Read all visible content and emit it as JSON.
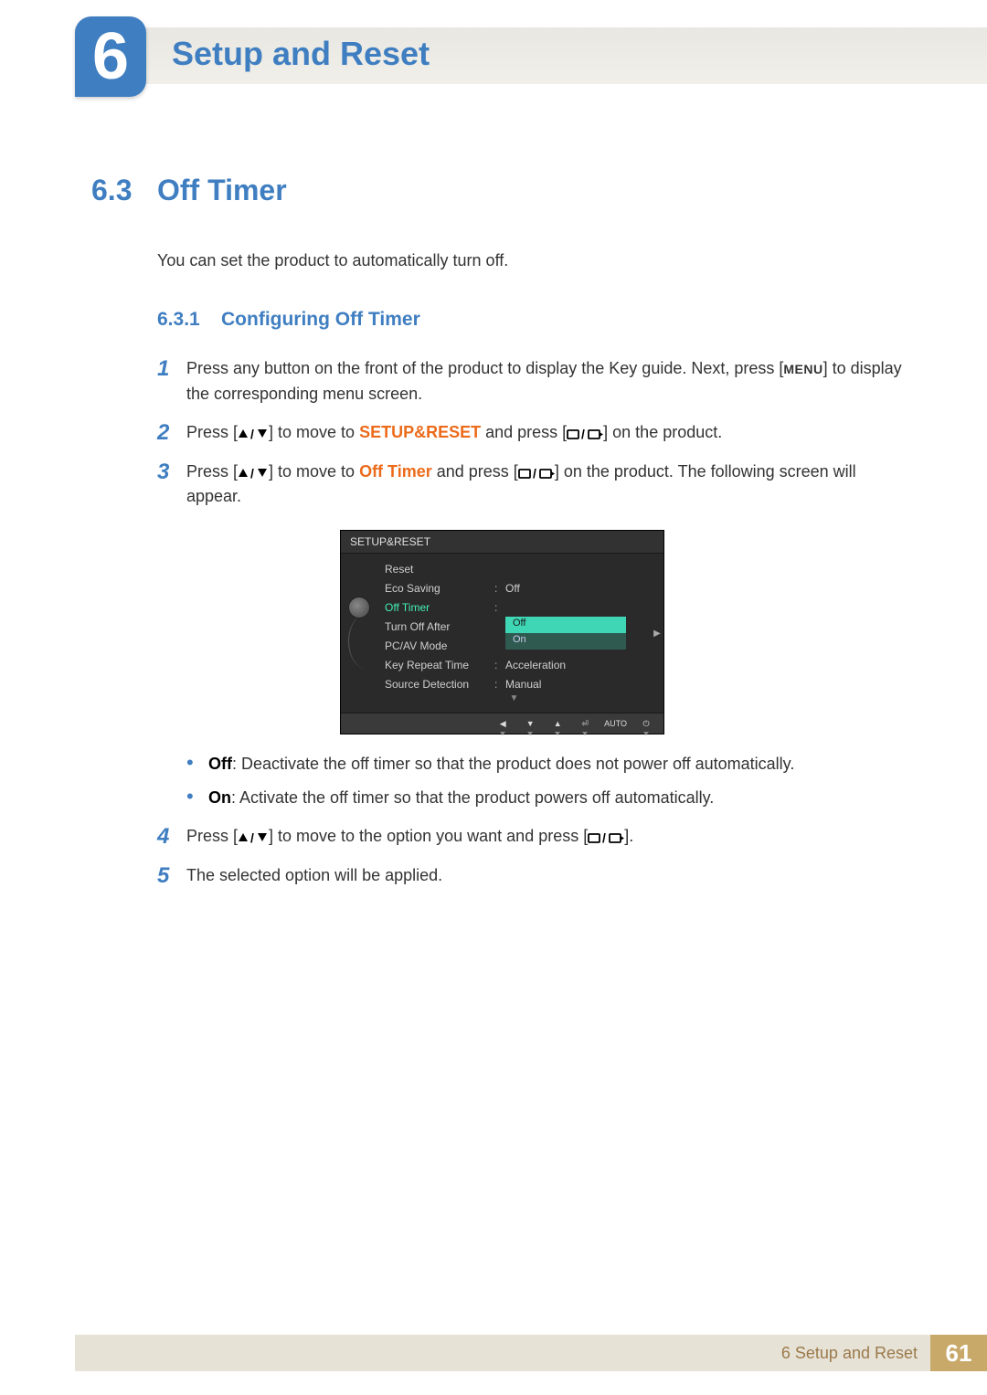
{
  "chapter": {
    "number": "6",
    "title": "Setup and Reset"
  },
  "section": {
    "number": "6.3",
    "title": "Off Timer"
  },
  "intro": "You can set the product to automatically turn off.",
  "subsection": {
    "number": "6.3.1",
    "title": "Configuring Off Timer"
  },
  "steps": {
    "s1": {
      "num": "1",
      "pre": "Press any button on the front of the product to display the Key guide. Next, press [",
      "menu": "MENU",
      "post": "] to display the corresponding menu screen."
    },
    "s2": {
      "num": "2",
      "pre": "Press [",
      "mid": "] to move to ",
      "target": "SETUP&RESET",
      "post1": " and press [",
      "post2": "] on the product."
    },
    "s3": {
      "num": "3",
      "pre": "Press [",
      "mid": "] to move to ",
      "target": "Off Timer",
      "post1": " and press [",
      "post2": "] on the product. The following screen will appear."
    },
    "s4": {
      "num": "4",
      "pre": "Press [",
      "mid": "] to move to the option you want and press [",
      "post": "]."
    },
    "s5": {
      "num": "5",
      "text": "The selected option will be applied."
    }
  },
  "osd": {
    "title": "SETUP&RESET",
    "items": {
      "reset": "Reset",
      "eco": "Eco Saving",
      "eco_val": "Off",
      "off_timer": "Off Timer",
      "turn_off_after": "Turn Off After",
      "pcav": "PC/AV Mode",
      "key_repeat": "Key Repeat Time",
      "key_repeat_val": "Acceleration",
      "source": "Source Detection",
      "source_val": "Manual"
    },
    "dropdown": {
      "off": "Off",
      "on": "On"
    },
    "footer": {
      "auto": "AUTO"
    }
  },
  "bullets": {
    "off": {
      "label": "Off",
      "text": ": Deactivate the off timer so that the product does not power off automatically."
    },
    "on": {
      "label": "On",
      "text": ": Activate the off timer so that the product powers off automatically."
    }
  },
  "footer": {
    "text": "6 Setup and Reset",
    "page": "61"
  }
}
